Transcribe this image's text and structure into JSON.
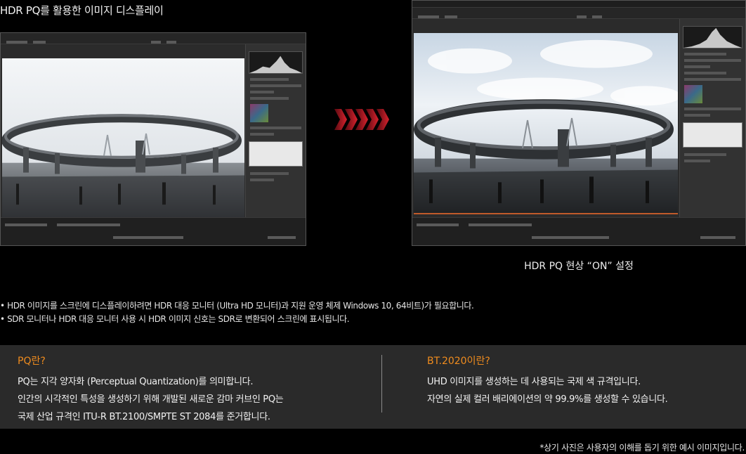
{
  "header": {
    "title": "HDR PQ를 활용한 이미지 디스플레이"
  },
  "comparison": {
    "caption": "HDR PQ 현상 “ON” 설정"
  },
  "notes": [
    "• HDR 이미지를 스크린에 디스플레이하려면 HDR 대응 모니터 (Ultra HD 모니터)과 지원 운영 체제 Windows 10, 64비트)가 필요합니다.",
    "• SDR 모니터나 HDR 대응 모니터 사용 시 HDR 이미지 신호는 SDR로 변환되어 스크린에 표시됩니다."
  ],
  "info": {
    "pq": {
      "heading": "PQ란?",
      "lines": [
        "PQ는 지각 양자화 (Perceptual Quantization)를 의미합니다.",
        "인간의 시각적인 특성을 생성하기 위해 개발된 새로운 감마 커브인 PQ는",
        "국제 산업 규격인 ITU-R BT.2100/SMPTE ST 2084를 준거합니다."
      ]
    },
    "bt2020": {
      "heading": "BT.2020이란?",
      "lines": [
        "UHD 이미지를 생성하는 데 사용되는 국제 색 규격입니다.",
        "자연의 실제 컬러 배리에이션의 약 99.9%를 생성할 수 있습니다."
      ]
    }
  },
  "disclaimer": "*상기 사진은 사용자의 이해를 돕기 위한 예시 이미지입니다.",
  "colors": {
    "accent": "#f08c1e",
    "arrow": "#c0202a",
    "panel": "#2a2a2a"
  }
}
